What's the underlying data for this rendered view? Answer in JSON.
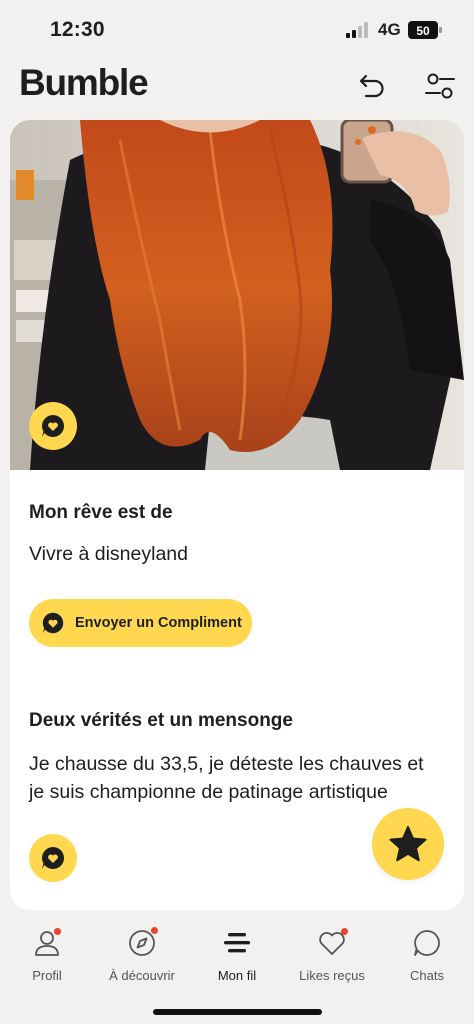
{
  "status_bar": {
    "time": "12:30",
    "network": "4G",
    "battery": "50"
  },
  "header": {
    "logo": "Bumble",
    "undo_icon": "undo-icon",
    "filters_icon": "filters-icon"
  },
  "profile": {
    "prompt1": {
      "title": "Mon rêve est de",
      "answer": "Vivre à disneyland"
    },
    "compliment_button": "Envoyer un Compliment",
    "prompt2": {
      "title": "Deux vérités et un mensonge",
      "answer": "Je chausse du 33,5, je déteste les chauves et je suis championne de patinage artistique"
    }
  },
  "nav": {
    "items": [
      {
        "label": "Profil",
        "icon": "person-icon",
        "badge": true
      },
      {
        "label": "À découvrir",
        "icon": "compass-icon",
        "badge": true
      },
      {
        "label": "Mon fil",
        "icon": "feed-icon",
        "badge": false,
        "active": true
      },
      {
        "label": "Likes reçus",
        "icon": "heart-icon",
        "badge": true
      },
      {
        "label": "Chats",
        "icon": "chat-icon",
        "badge": false
      }
    ]
  },
  "colors": {
    "accent": "#ffd84f",
    "badge": "#e8452c",
    "text": "#1e1e1e",
    "background": "#f3f1ef"
  }
}
